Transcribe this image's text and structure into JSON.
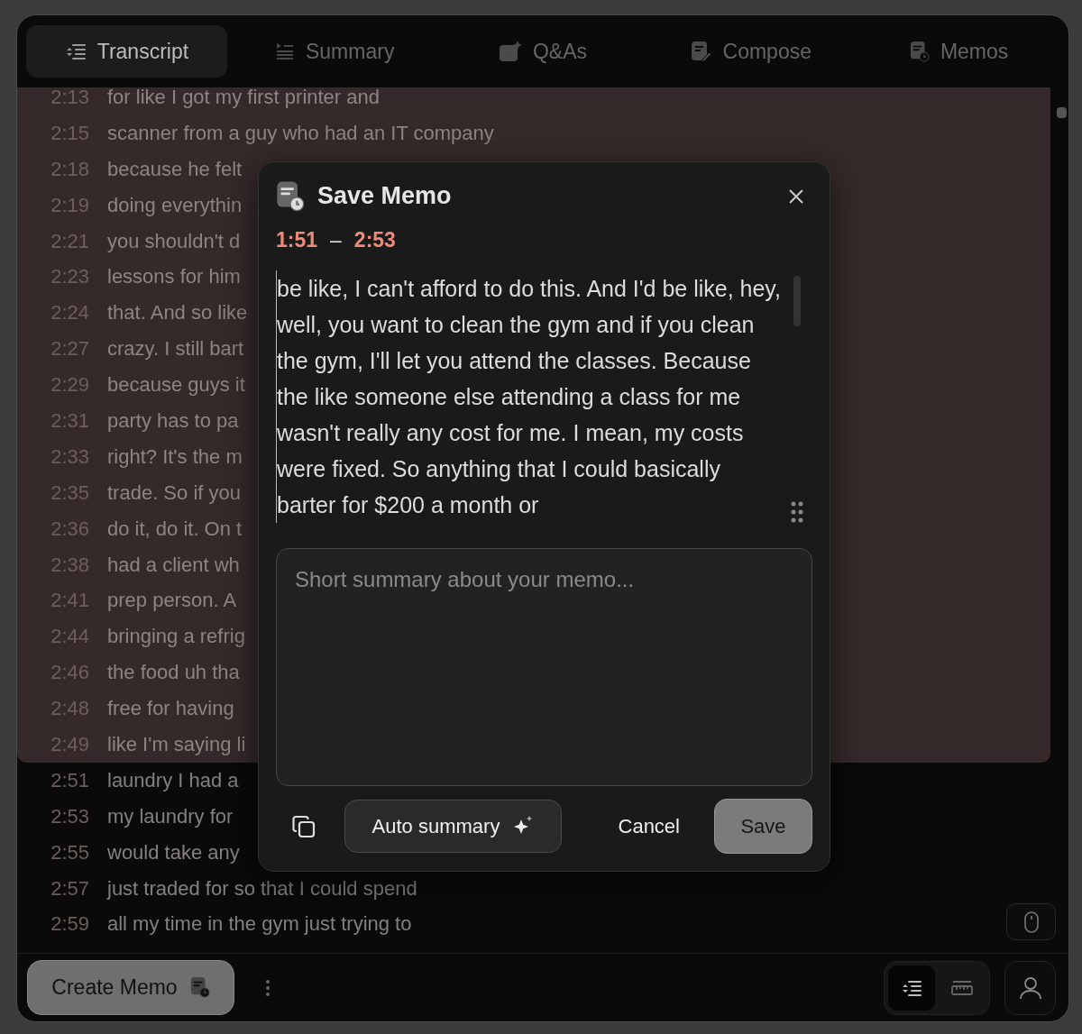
{
  "tabs": [
    {
      "label": "Transcript",
      "selected": true
    },
    {
      "label": "Summary",
      "selected": false
    },
    {
      "label": "Q&As",
      "selected": false
    },
    {
      "label": "Compose",
      "selected": false
    },
    {
      "label": "Memos",
      "selected": false
    }
  ],
  "transcript": [
    {
      "time": "2:13",
      "text": "for like I got my first printer and",
      "highlighted": true
    },
    {
      "time": "2:15",
      "text": "scanner from a guy who had an IT company",
      "highlighted": true
    },
    {
      "time": "2:18",
      "text": "because he felt",
      "highlighted": true
    },
    {
      "time": "2:19",
      "text": "doing everythin",
      "highlighted": true
    },
    {
      "time": "2:21",
      "text": "you shouldn't d",
      "highlighted": true
    },
    {
      "time": "2:23",
      "text": "lessons for him",
      "highlighted": true
    },
    {
      "time": "2:24",
      "text": "that. And so like",
      "highlighted": true
    },
    {
      "time": "2:27",
      "text": "crazy. I still bart",
      "highlighted": true
    },
    {
      "time": "2:29",
      "text": "because guys it",
      "highlighted": true
    },
    {
      "time": "2:31",
      "text": "party has to pa",
      "highlighted": true
    },
    {
      "time": "2:33",
      "text": "right? It's the m",
      "highlighted": true
    },
    {
      "time": "2:35",
      "text": "trade. So if you",
      "highlighted": true
    },
    {
      "time": "2:36",
      "text": "do it, do it. On t",
      "highlighted": true
    },
    {
      "time": "2:38",
      "text": "had a client wh",
      "highlighted": true
    },
    {
      "time": "2:41",
      "text": "prep person. A",
      "highlighted": true
    },
    {
      "time": "2:44",
      "text": "bringing a refrig",
      "highlighted": true
    },
    {
      "time": "2:46",
      "text": "the food uh tha",
      "highlighted": true
    },
    {
      "time": "2:48",
      "text": "free for having",
      "highlighted": true
    },
    {
      "time": "2:49",
      "text": "like I'm saying li",
      "highlighted": true
    },
    {
      "time": "2:51",
      "text": "laundry I had a",
      "highlighted": false
    },
    {
      "time": "2:53",
      "text": "my laundry for",
      "highlighted": false
    },
    {
      "time": "2:55",
      "text": "would take any",
      "highlighted": false
    },
    {
      "time": "2:57",
      "text": "just traded for so that I could spend",
      "highlighted": false
    },
    {
      "time": "2:59",
      "text": "all my time in the gym just trying to",
      "highlighted": false
    }
  ],
  "dialog": {
    "title": "Save Memo",
    "range_start": "1:51",
    "range_separator": "–",
    "range_end": "2:53",
    "memo_text": "be like, I can't afford to do this. And I'd be like, hey, well, you want to clean the gym and if you clean the gym, I'll let you attend the classes. Because the like someone else attending a class for me wasn't really any cost for me. I mean, my costs were fixed. So anything that I could basically barter for $200 a month or",
    "summary_placeholder": "Short summary about your memo...",
    "auto_summary": "Auto summary",
    "cancel": "Cancel",
    "save": "Save"
  },
  "bottom_bar": {
    "create_memo": "Create Memo",
    "view_modes": [
      {
        "selected": true
      },
      {
        "selected": false
      }
    ]
  }
}
